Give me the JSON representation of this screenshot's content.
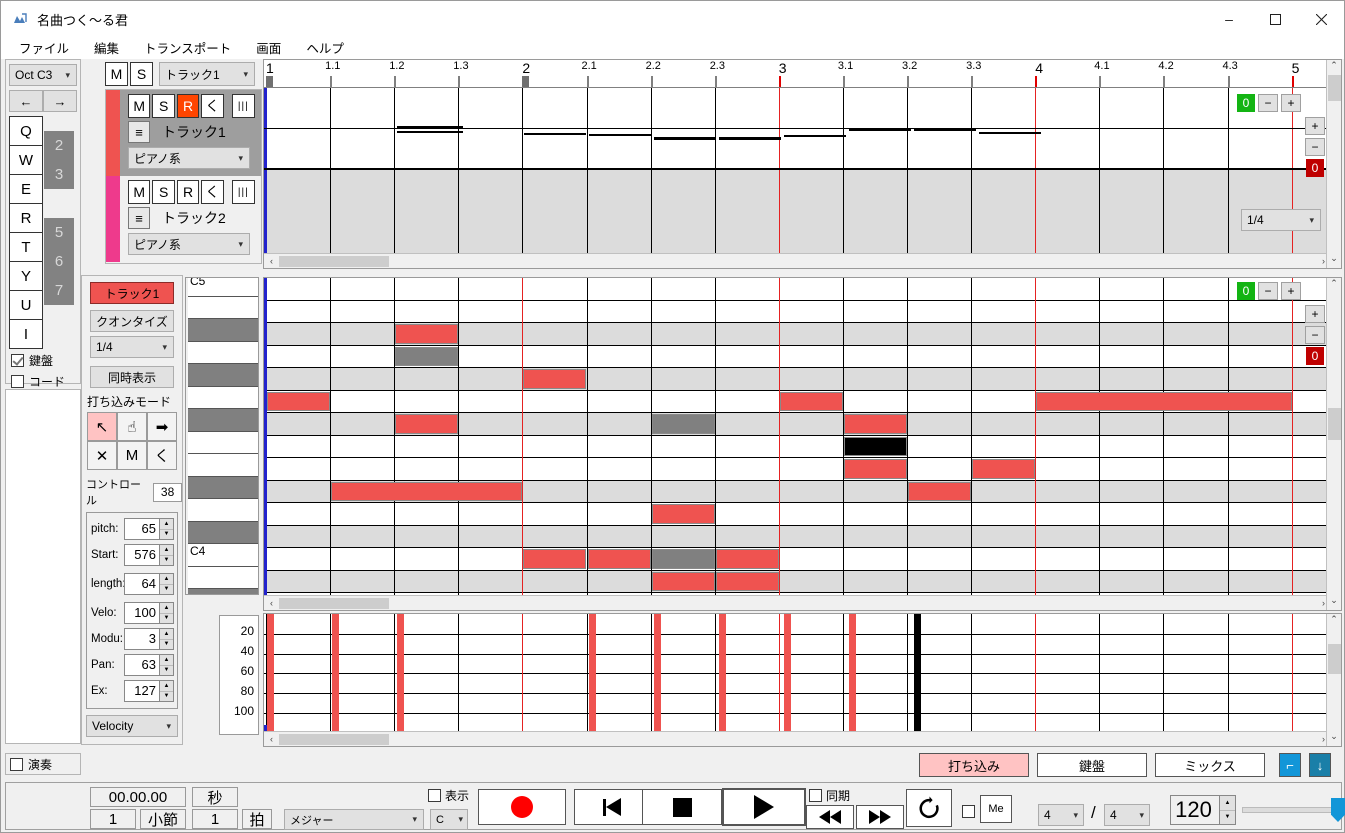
{
  "window": {
    "title": "名曲つく〜る君",
    "icon": "app-icon",
    "minimize": "–",
    "maximize": "☐",
    "close": "✕"
  },
  "menubar": {
    "items": [
      "ファイル",
      "編集",
      "トランスポート",
      "画面",
      "ヘルプ"
    ]
  },
  "keyboard_panel": {
    "octave_select": "Oct C3",
    "prev_label": "←",
    "next_label": "→",
    "white_keys": [
      "Q",
      "W",
      "E",
      "R",
      "T",
      "Y",
      "U",
      "I"
    ],
    "black_keys": [
      "2",
      "3",
      "5",
      "6",
      "7"
    ],
    "checkboxes": [
      {
        "label": "鍵盤",
        "checked": true
      },
      {
        "label": "コード",
        "checked": false
      }
    ],
    "play_checkbox": {
      "label": "演奏",
      "checked": false
    }
  },
  "track_panel": {
    "header": {
      "mute": "M",
      "solo": "S",
      "select_value": "トラック1"
    },
    "tracks": [
      {
        "mute": "M",
        "solo": "S",
        "rec": "R",
        "back": "く",
        "more": "|||",
        "eq": "≡",
        "name": "トラック1",
        "instrument": "ピアノ系",
        "color": "#ef5350",
        "selected": true,
        "rec_active": true
      },
      {
        "mute": "M",
        "solo": "S",
        "rec": "R",
        "back": "く",
        "more": "|||",
        "eq": "≡",
        "name": "トラック2",
        "instrument": "ピアノ系",
        "color": "#ee3a8c",
        "selected": false,
        "rec_active": false
      }
    ]
  },
  "arrangement": {
    "ruler_labels": [
      "1",
      "1.1",
      "1.2",
      "1.3",
      "2",
      "2.1",
      "2.2",
      "2.3",
      "3",
      "3.1",
      "3.2",
      "3.3",
      "4",
      "4.1",
      "4.2",
      "4.3",
      "5"
    ],
    "zoom_h": {
      "value": "0",
      "minus": "−",
      "plus": "+"
    },
    "zoom_v": {
      "plus": "+",
      "minus": "−",
      "value": "0"
    },
    "quantize": "1/4",
    "scroll_left": "‹",
    "scroll_right": "›",
    "scroll_up": "⌃",
    "scroll_down": "⌄"
  },
  "editor": {
    "track_tab": "トラック1",
    "quantize_button": "クオンタイズ",
    "quantize_value": "1/4",
    "simultaneous_button": "同時表示",
    "mode_label": "打ち込みモード",
    "mode_buttons": [
      {
        "icon": "arrow-select-icon",
        "glyph": "↖",
        "active": true
      },
      {
        "icon": "hand-icon",
        "glyph": "☝",
        "active": false
      },
      {
        "icon": "arrow-right-icon",
        "glyph": "➡",
        "active": false
      },
      {
        "icon": "delete-icon",
        "glyph": "✕",
        "active": false
      },
      {
        "icon": "mute-icon",
        "glyph": "M",
        "active": false
      },
      {
        "icon": "back-icon",
        "glyph": "く",
        "active": false
      }
    ],
    "control_label": "コントロール",
    "control_value": "38",
    "params": [
      {
        "label": "pitch:",
        "value": "65"
      },
      {
        "label": "Start:",
        "value": "576"
      },
      {
        "label": "length:",
        "value": "64"
      },
      {
        "label": "Velo:",
        "value": "100"
      },
      {
        "label": "Modu:",
        "value": "3"
      },
      {
        "label": "Pan:",
        "value": "63"
      },
      {
        "label": "Ex:",
        "value": "127"
      }
    ],
    "lane_select": "Velocity"
  },
  "piano_roll": {
    "key_labels": {
      "c5": "C5",
      "c4": "C4"
    },
    "zoom_h": {
      "value": "0",
      "minus": "−",
      "plus": "+"
    },
    "zoom_v": {
      "plus": "+",
      "minus": "−",
      "value": "0"
    }
  },
  "velocity_panel": {
    "scale": [
      "20",
      "40",
      "60",
      "80",
      "100"
    ]
  },
  "bottom_tabs": {
    "tabs": [
      {
        "label": "打ち込み",
        "active": true
      },
      {
        "label": "鍵盤",
        "active": false
      },
      {
        "label": "ミックス",
        "active": false
      }
    ],
    "icon_buttons": [
      {
        "name": "corner-icon",
        "glyph": "⌐"
      },
      {
        "name": "download-icon",
        "glyph": "↓"
      }
    ]
  },
  "transport": {
    "time_display": "00.00.00",
    "time_unit": "秒",
    "bar_value": "1",
    "bar_unit": "小節",
    "beat_value": "1",
    "beat_unit": "拍",
    "scale_select": "メジャー",
    "key_select": "C",
    "display_checkbox": {
      "label": "表示",
      "checked": false
    },
    "sync_checkbox": {
      "label": "同期",
      "checked": false
    },
    "record": "●",
    "to_start": "|◀",
    "stop": "■",
    "play": "▶",
    "rewind": "◀◀",
    "forward": "▶▶",
    "loop": "↻",
    "metronome_checkbox": {
      "checked": false
    },
    "metronome_button": "Me",
    "time_sig_num": "4",
    "time_sig_slash": "/",
    "time_sig_den": "4",
    "tempo": "120",
    "volume_slider": "volume-slider"
  },
  "colors": {
    "accent_red": "#ef5350",
    "track2": "#ee3a8c",
    "zoom_green": "#13b413",
    "zoom_red": "#bf0000",
    "playhead_red": "#e52222",
    "marker_blue": "#2222cc"
  }
}
